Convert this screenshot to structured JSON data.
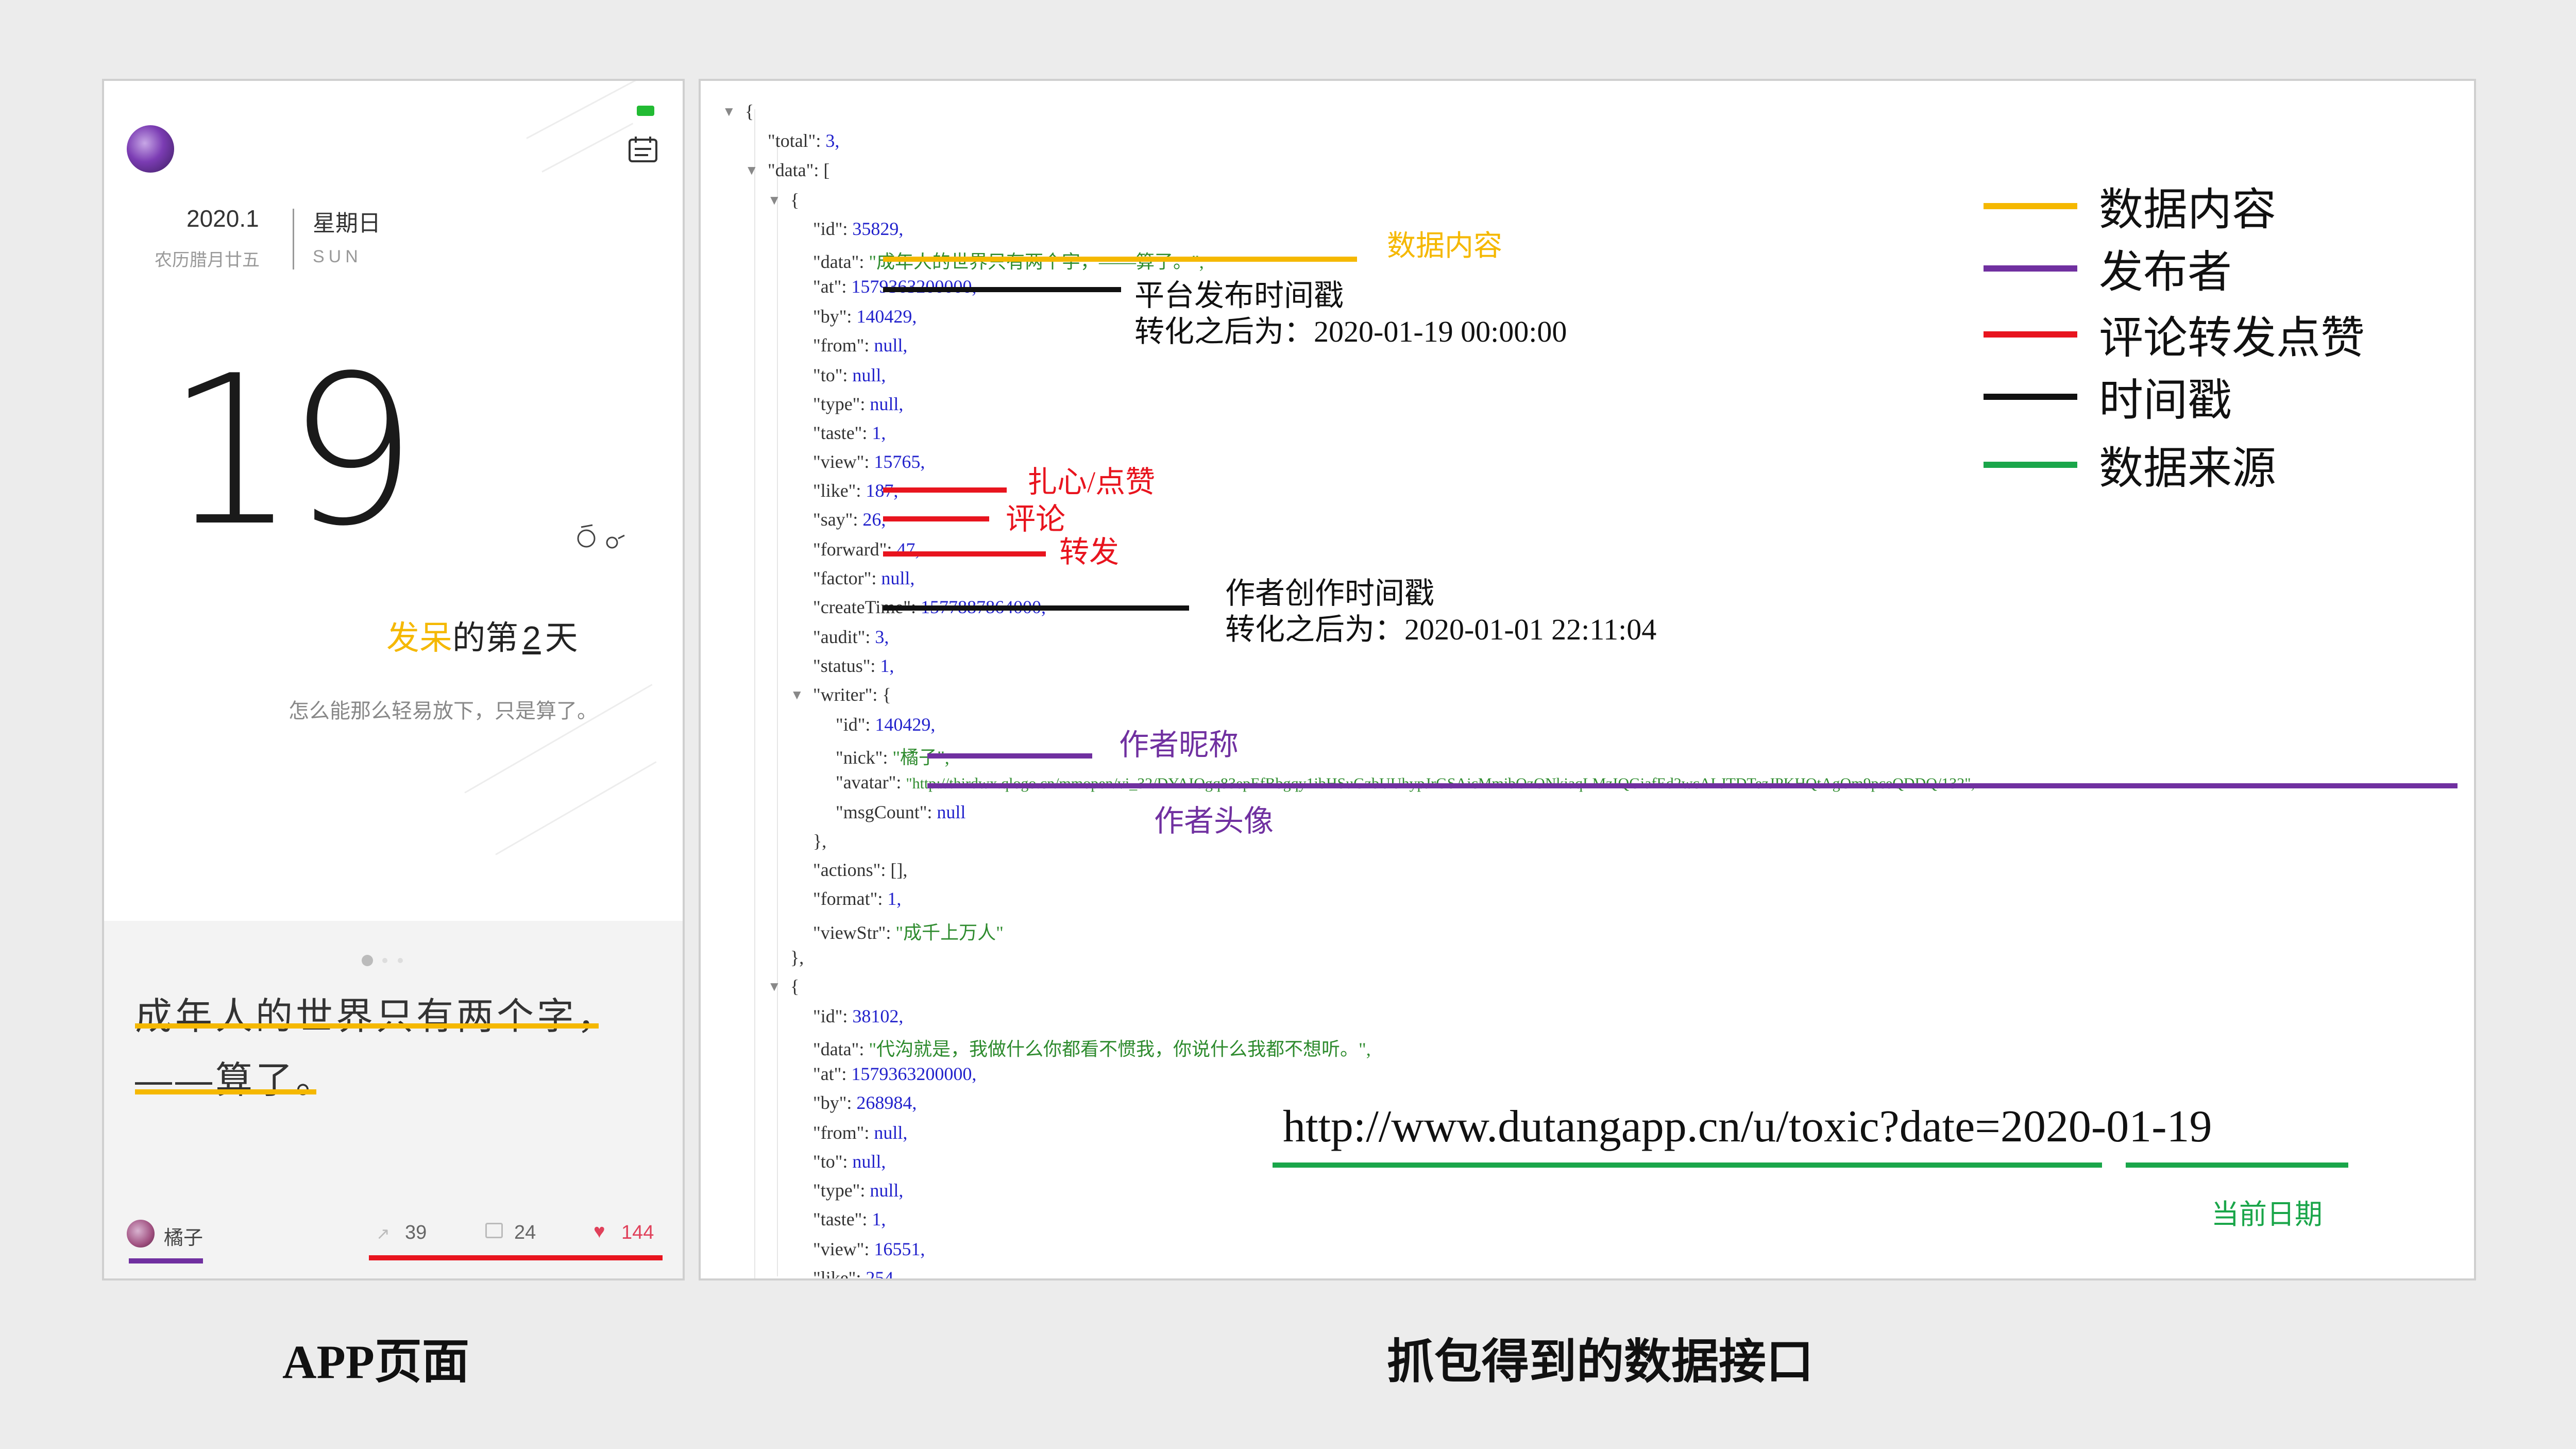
{
  "app_page": {
    "month": "2020.1",
    "weekday": "星期日",
    "lunar": "农历腊月廿五",
    "weekday_en": "SUN",
    "day": "19",
    "mood_word": "发呆",
    "mood_prefix": "的第",
    "mood_count": "2",
    "mood_suffix": "天",
    "subtitle": "怎么能那么轻易放下，只是算了。",
    "quote_line1": "成年人的世界只有两个字，",
    "quote_line2": "——算了。",
    "author_name": "橘子",
    "forward_count": "39",
    "comment_count": "24",
    "like_count": "144",
    "status_color": "#22bb33"
  },
  "json_view": {
    "lines": [
      {
        "t": "{"
      },
      {
        "k": "\"total\":",
        "v": "3,",
        "c": "num"
      },
      {
        "k": "\"data\":",
        "v": "[",
        "c": "plain"
      },
      {
        "t": "{"
      },
      {
        "k": "\"id\":",
        "v": "35829,",
        "c": "num"
      },
      {
        "k": "\"data\":",
        "v": "\"成年人的世界只有两个字，——算了。\",",
        "c": "str"
      },
      {
        "k": "\"at\":",
        "v": "1579363200000,",
        "c": "num"
      },
      {
        "k": "\"by\":",
        "v": "140429,",
        "c": "num"
      },
      {
        "k": "\"from\":",
        "v": "null,",
        "c": "num"
      },
      {
        "k": "\"to\":",
        "v": "null,",
        "c": "num"
      },
      {
        "k": "\"type\":",
        "v": "null,",
        "c": "num"
      },
      {
        "k": "\"taste\":",
        "v": "1,",
        "c": "num"
      },
      {
        "k": "\"view\":",
        "v": "15765,",
        "c": "num"
      },
      {
        "k": "\"like\":",
        "v": "187,",
        "c": "num"
      },
      {
        "k": "\"say\":",
        "v": "26,",
        "c": "num"
      },
      {
        "k": "\"forward\":",
        "v": "47,",
        "c": "num"
      },
      {
        "k": "\"factor\":",
        "v": "null,",
        "c": "num"
      },
      {
        "k": "\"createTime\":",
        "v": "1577887864000,",
        "c": "num"
      },
      {
        "k": "\"audit\":",
        "v": "3,",
        "c": "num"
      },
      {
        "k": "\"status\":",
        "v": "1,",
        "c": "num"
      },
      {
        "k": "\"writer\":",
        "v": "{",
        "c": "plain"
      },
      {
        "k": "\"id\":",
        "v": "140429,",
        "c": "num"
      },
      {
        "k": "\"nick\":",
        "v": "\"橘子\",",
        "c": "str"
      },
      {
        "k": "\"avatar\":",
        "v": "\"http://thirdwx.qlogo.cn/mmopen/vi_32/DYAIOgq83epEfBbgqy1ibHSuGzbUUhypJrGSAicMmibOzONkiaqLMzIQGiafEd2wcALJTDTezJPKHQtAgOm9pceQDDQ/132\",",
        "c": "str"
      },
      {
        "k": "\"msgCount\":",
        "v": "null",
        "c": "num"
      },
      {
        "t": "},"
      },
      {
        "k": "\"actions\":",
        "v": "[],",
        "c": "plain"
      },
      {
        "k": "\"format\":",
        "v": "1,",
        "c": "num"
      },
      {
        "k": "\"viewStr\":",
        "v": "\"成千上万人\"",
        "c": "str"
      },
      {
        "t": "},"
      },
      {
        "t": "{"
      },
      {
        "k": "\"id\":",
        "v": "38102,",
        "c": "num"
      },
      {
        "k": "\"data\":",
        "v": "\"代沟就是，我做什么你都看不惯我，你说什么我都不想听。\",",
        "c": "str"
      },
      {
        "k": "\"at\":",
        "v": "1579363200000,",
        "c": "num"
      },
      {
        "k": "\"by\":",
        "v": "268984,",
        "c": "num"
      },
      {
        "k": "\"from\":",
        "v": "null,",
        "c": "num"
      },
      {
        "k": "\"to\":",
        "v": "null,",
        "c": "num"
      },
      {
        "k": "\"type\":",
        "v": "null,",
        "c": "num"
      },
      {
        "k": "\"taste\":",
        "v": "1,",
        "c": "num"
      },
      {
        "k": "\"view\":",
        "v": "16551,",
        "c": "num"
      },
      {
        "k": "\"like\":",
        "v": "254,",
        "c": "num"
      }
    ]
  },
  "annotations": {
    "data_content": "数据内容",
    "platform_time": "平台发布时间戳",
    "platform_time_converted": "转化之后为：2020-01-19 00:00:00",
    "like": "扎心/点赞",
    "comment": "评论",
    "forward": "转发",
    "create_time": "作者创作时间戳",
    "create_time_converted": "转化之后为：2020-01-01 22:11:04",
    "nickname": "作者昵称",
    "avatar": "作者头像",
    "url": "http://www.dutangapp.cn/u/toxic?date=2020-01-19",
    "current_date": "当前日期"
  },
  "legend": [
    {
      "label": "数据内容",
      "color": "#f5b800"
    },
    {
      "label": "发布者",
      "color": "#7030a0"
    },
    {
      "label": "评论转发点赞",
      "color": "#e8141e"
    },
    {
      "label": "时间戳",
      "color": "#111111"
    },
    {
      "label": "数据来源",
      "color": "#1aa64a"
    }
  ],
  "captions": {
    "left": "APP页面",
    "right": "抓包得到的数据接口"
  },
  "colors": {
    "yellow": "#f5b800",
    "purple": "#7030a0",
    "red": "#e8141e",
    "black": "#111111",
    "green": "#1aa64a"
  }
}
